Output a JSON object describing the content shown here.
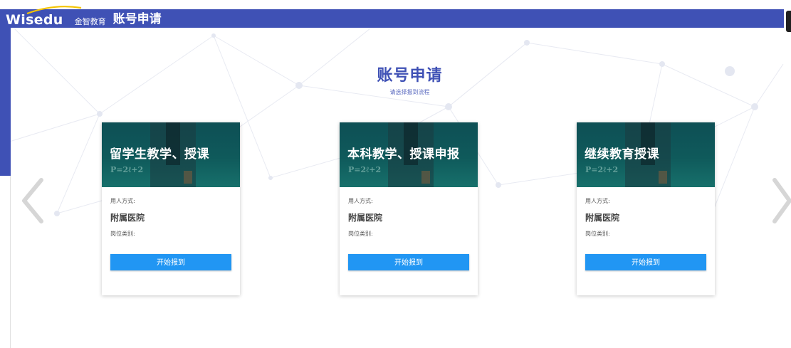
{
  "brand": {
    "logo_text": "Wisedu",
    "logo_sub": "金智教育",
    "app_title": "账号申请"
  },
  "hero": {
    "title": "账号申请",
    "subtitle": "请选择报到流程"
  },
  "cards": [
    {
      "title": "留学生教学、授课",
      "employment_label": "用人方式:",
      "employment_value": "附属医院",
      "category_label": "岗位类别:",
      "button_label": "开始报到"
    },
    {
      "title": "本科教学、授课申报",
      "employment_label": "用人方式:",
      "employment_value": "附属医院",
      "category_label": "岗位类别:",
      "button_label": "开始报到"
    },
    {
      "title": "继续教育授课",
      "employment_label": "用人方式:",
      "employment_value": "附属医院",
      "category_label": "岗位类别:",
      "button_label": "开始报到"
    }
  ],
  "banner_formula": "P=2ℓ+2",
  "icons": {
    "prev": "chevron-left-icon",
    "next": "chevron-right-icon"
  },
  "colors": {
    "header": "#3f51b5",
    "title": "#3f51b5",
    "button": "#2196f3",
    "banner": "#0f5a5b"
  }
}
